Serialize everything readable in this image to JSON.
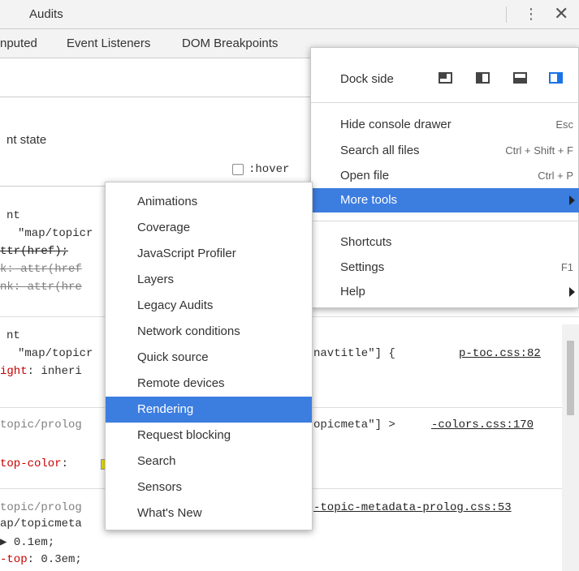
{
  "topbar": {
    "tab_label": "Audits",
    "kebab_glyph": "⋮",
    "close_glyph": "✕"
  },
  "subtabs": {
    "computed": "nputed",
    "event_listeners": "Event Listeners",
    "dom_breakpoints": "DOM Breakpoints"
  },
  "state_pane": {
    "label": "nt state",
    "hover_label": ":hover"
  },
  "styles": {
    "r1": {
      "l1": "nt",
      "l2": "\"map/topicr",
      "l3": "ttr(href);",
      "l4": "k: attr(href",
      "l5": "nk: attr(hre"
    },
    "r2": {
      "l1": "nt",
      "l2": "\"map/topicr",
      "l2b": "navtitle\"] {",
      "link": "p-toc.css:82",
      "l3p": "ight",
      "l3v": ": inheri"
    },
    "r3": {
      "l1": "topic/prolog",
      "l1b": "opicmeta\"] >",
      "link": "-colors.css:170",
      "l2p": "top-color",
      "l2v": ": "
    },
    "r4": {
      "l1": "topic/prolog",
      "link": "-topic-metadata-prolog.css:53",
      "l2": "ap/topicmeta",
      "l3": "▶ 0.1em;",
      "l4p": "-top",
      "l4v": ": 0.3em;"
    }
  },
  "main_menu": {
    "dock_side": "Dock side",
    "items": [
      {
        "label": "Hide console drawer",
        "shortcut": "Esc"
      },
      {
        "label": "Search all files",
        "shortcut": "Ctrl + Shift + F"
      },
      {
        "label": "Open file",
        "shortcut": "Ctrl + P"
      },
      {
        "label": "More tools",
        "shortcut": ""
      },
      {
        "label": "Shortcuts",
        "shortcut": ""
      },
      {
        "label": "Settings",
        "shortcut": "F1"
      },
      {
        "label": "Help",
        "shortcut": ""
      }
    ]
  },
  "more_tools": {
    "items": [
      "Animations",
      "Coverage",
      "JavaScript Profiler",
      "Layers",
      "Legacy Audits",
      "Network conditions",
      "Quick source",
      "Remote devices",
      "Rendering",
      "Request blocking",
      "Search",
      "Sensors",
      "What's New"
    ],
    "highlighted": "Rendering"
  },
  "colors": {
    "highlight": "#3c7de0",
    "property": "#c80000",
    "swatch": "#e8e000"
  }
}
